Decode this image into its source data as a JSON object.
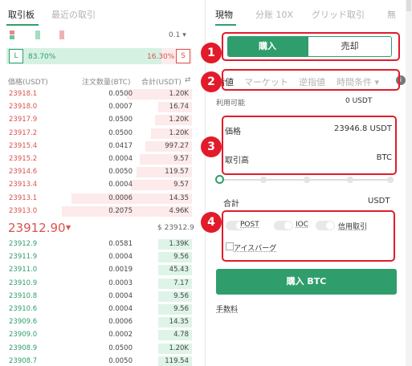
{
  "left": {
    "tabs": [
      {
        "label": "取引板"
      },
      {
        "label": "最近の取引"
      }
    ],
    "precision": "0.1",
    "ratio": {
      "buy": "83.70%",
      "sell": "16.30%",
      "buy_letter": "L",
      "sell_letter": "S",
      "buy_fraction": 0.837
    },
    "headers": {
      "price": "価格(USDT)",
      "qty": "注文数量(BTC)",
      "total": "合計(USDT)"
    },
    "asks": [
      {
        "price": "23918.1",
        "qty": "0.0500",
        "total": "1.20K",
        "depth": 0.35
      },
      {
        "price": "23918.0",
        "qty": "0.0007",
        "total": "16.74",
        "depth": 0.18
      },
      {
        "price": "23917.9",
        "qty": "0.0500",
        "total": "1.20K",
        "depth": 0.2
      },
      {
        "price": "23917.2",
        "qty": "0.0500",
        "total": "1.20K",
        "depth": 0.22
      },
      {
        "price": "23915.4",
        "qty": "0.0417",
        "total": "997.27",
        "depth": 0.25
      },
      {
        "price": "23915.2",
        "qty": "0.0004",
        "total": "9.57",
        "depth": 0.28
      },
      {
        "price": "23914.6",
        "qty": "0.0050",
        "total": "119.57",
        "depth": 0.3
      },
      {
        "price": "23913.4",
        "qty": "0.0004",
        "total": "9.57",
        "depth": 0.33
      },
      {
        "price": "23913.1",
        "qty": "0.0006",
        "total": "14.35",
        "depth": 0.65
      },
      {
        "price": "23913.0",
        "qty": "0.2075",
        "total": "4.96K",
        "depth": 0.7
      }
    ],
    "last_price": "23912.90",
    "last_arrow": "▼",
    "mark_price": "$ 23912.9",
    "bids": [
      {
        "price": "23912.9",
        "qty": "0.0581",
        "total": "1.39K",
        "depth": 0.18
      },
      {
        "price": "23911.9",
        "qty": "0.0004",
        "total": "9.56",
        "depth": 0.18
      },
      {
        "price": "23911.0",
        "qty": "0.0019",
        "total": "45.43",
        "depth": 0.18
      },
      {
        "price": "23910.9",
        "qty": "0.0003",
        "total": "7.17",
        "depth": 0.18
      },
      {
        "price": "23910.8",
        "qty": "0.0004",
        "total": "9.56",
        "depth": 0.18
      },
      {
        "price": "23910.6",
        "qty": "0.0004",
        "total": "9.56",
        "depth": 0.18
      },
      {
        "price": "23909.6",
        "qty": "0.0006",
        "total": "14.35",
        "depth": 0.18
      },
      {
        "price": "23909.0",
        "qty": "0.0002",
        "total": "4.78",
        "depth": 0.18
      },
      {
        "price": "23908.9",
        "qty": "0.0500",
        "total": "1.20K",
        "depth": 0.18
      },
      {
        "price": "23908.7",
        "qty": "0.0050",
        "total": "119.54",
        "depth": 0.18
      }
    ]
  },
  "right": {
    "tabs": [
      "現物",
      "分账 10X",
      "グリッド取引",
      "無"
    ],
    "side": {
      "buy": "購入",
      "sell": "売却"
    },
    "order_types": [
      "指値",
      "マーケット",
      "逆指値",
      "時間条件"
    ],
    "order_type_chevron": "▾",
    "info_icon": "i",
    "available_label": "利用可能",
    "available_value": "0 USDT",
    "price_label": "価格",
    "price_value": "23946.8 USDT",
    "amount_label": "取引高",
    "amount_unit": "BTC",
    "total_label": "合計",
    "total_unit": "USDT",
    "options": {
      "post": "POST",
      "ioc": "IOC",
      "margin": "信用取引",
      "iceberg": "アイスバーグ"
    },
    "submit": "購入 BTC",
    "fee_label": "手数料"
  },
  "annotations": [
    "1",
    "2",
    "3",
    "4"
  ],
  "colors": {
    "green": "#2f9e6c",
    "red": "#d9534f",
    "annotation": "#e21b2b"
  }
}
